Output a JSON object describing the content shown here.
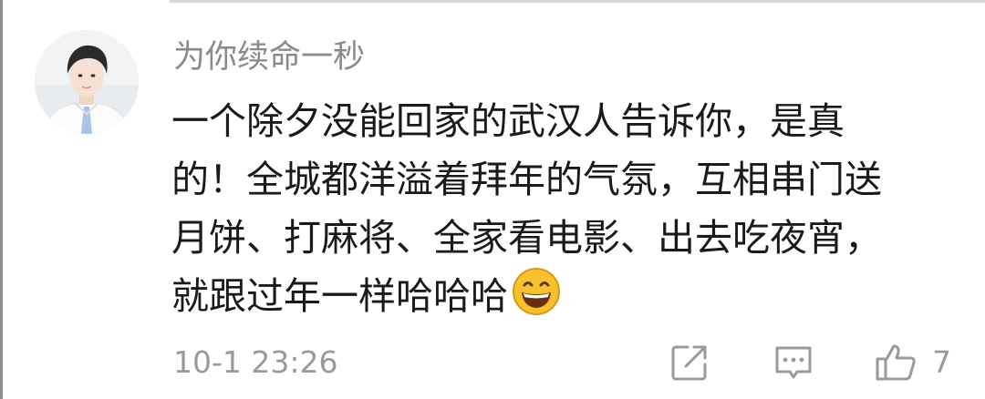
{
  "comment": {
    "username": "为你续命一秒",
    "lines": [
      "一个除夕没能回家的武汉人告诉你，是真",
      "的！全城都洋溢着拜年的气氛，互相串门送",
      "月饼、打麻将、全家看电影、出去吃夜宵，",
      "就跟过年一样哈哈哈"
    ],
    "emoji": "grinning-face-icon",
    "timestamp": "10-1 23:26",
    "like_count": "7"
  },
  "icons": {
    "share": "share-icon",
    "reply": "reply-icon",
    "like": "thumbs-up-icon"
  },
  "colors": {
    "username": "#8a8a8a",
    "text": "#1a1a1a",
    "meta": "#9a9a9a",
    "emoji_face": "#f9c02e"
  }
}
